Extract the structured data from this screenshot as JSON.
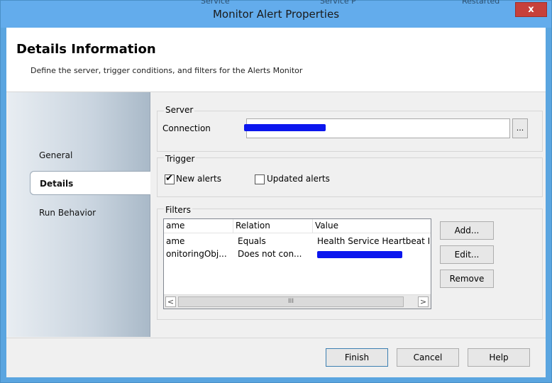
{
  "window": {
    "title": "Monitor Alert Properties",
    "close_label": "x",
    "background_fragments": [
      "Service",
      "Service P",
      "Restarted"
    ]
  },
  "header": {
    "title": "Details Information",
    "subtitle": "Define the server, trigger conditions, and filters for the Alerts Monitor"
  },
  "nav": {
    "items": [
      {
        "label": "General",
        "active": false
      },
      {
        "label": "Details",
        "active": true
      },
      {
        "label": "Run Behavior",
        "active": false
      }
    ]
  },
  "server": {
    "group_label": "Server",
    "connection_label": "Connection",
    "browse_label": "..."
  },
  "trigger": {
    "group_label": "Trigger",
    "new_alerts_label": "New alerts",
    "new_alerts_checked": true,
    "updated_alerts_label": "Updated alerts",
    "updated_alerts_checked": false
  },
  "filters": {
    "group_label": "Filters",
    "columns": [
      "ame",
      "Relation",
      "Value"
    ],
    "rows": [
      [
        "ame",
        "Equals",
        "Health Service Heartbeat I"
      ],
      [
        "onitoringObj...",
        "Does not con...",
        ""
      ]
    ],
    "scroll_left": "<",
    "scroll_right": ">",
    "scroll_thumb": "III",
    "add_label": "Add...",
    "edit_label": "Edit...",
    "remove_label": "Remove"
  },
  "footer": {
    "finish_label": "Finish",
    "cancel_label": "Cancel",
    "help_label": "Help"
  },
  "colors": {
    "titlebar": "#63acec",
    "close": "#c7403a",
    "redaction": "#0b16ee"
  }
}
